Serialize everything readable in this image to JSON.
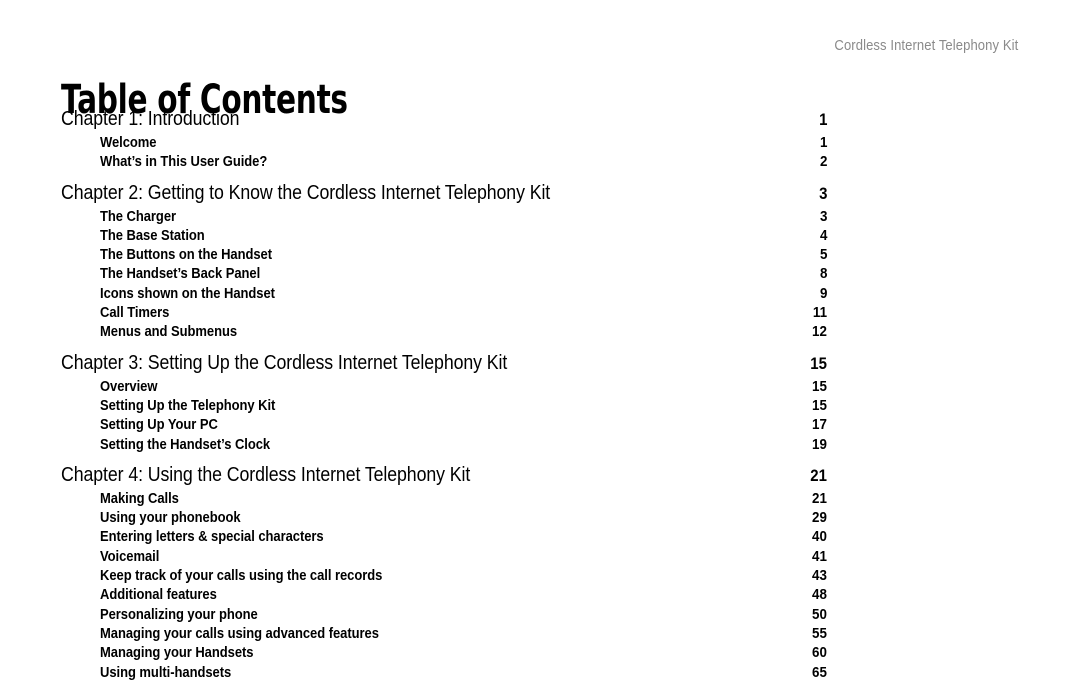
{
  "header": {
    "running_title": "Cordless Internet Telephony Kit"
  },
  "title": "Table of Contents",
  "colors": {
    "text": "#000000",
    "header_gray": "#8a8a8a",
    "background": "#ffffff"
  },
  "toc": {
    "rows": [
      {
        "type": "chapter",
        "label": "Chapter 1: Introduction",
        "page": "1"
      },
      {
        "type": "entry",
        "label": "Welcome",
        "page": "1"
      },
      {
        "type": "entry",
        "label": "What’s in This User Guide?",
        "page": "2"
      },
      {
        "type": "chapter",
        "label": "Chapter 2: Getting to Know the Cordless Internet Telephony Kit",
        "page": "3"
      },
      {
        "type": "entry",
        "label": "The Charger",
        "page": "3"
      },
      {
        "type": "entry",
        "label": "The Base Station",
        "page": "4"
      },
      {
        "type": "entry",
        "label": "The Buttons on the Handset",
        "page": "5"
      },
      {
        "type": "entry",
        "label": "The Handset’s Back Panel",
        "page": "8"
      },
      {
        "type": "entry",
        "label": "Icons shown on the Handset",
        "page": "9"
      },
      {
        "type": "entry",
        "label": "Call Timers",
        "page": "11"
      },
      {
        "type": "entry",
        "label": "Menus and Submenus",
        "page": "12"
      },
      {
        "type": "chapter",
        "label": "Chapter 3: Setting Up the Cordless Internet Telephony Kit",
        "page": "15"
      },
      {
        "type": "entry",
        "label": "Overview",
        "page": "15"
      },
      {
        "type": "entry",
        "label": "Setting Up the Telephony Kit",
        "page": "15"
      },
      {
        "type": "entry",
        "label": "Setting Up Your PC",
        "page": "17"
      },
      {
        "type": "entry",
        "label": "Setting the Handset’s Clock",
        "page": "19"
      },
      {
        "type": "chapter",
        "label": "Chapter 4: Using the Cordless Internet Telephony Kit",
        "page": "21"
      },
      {
        "type": "entry",
        "label": "Making Calls",
        "page": "21"
      },
      {
        "type": "entry",
        "label": "Using your phonebook",
        "page": "29"
      },
      {
        "type": "entry",
        "label": "Entering letters & special characters",
        "page": "40"
      },
      {
        "type": "entry",
        "label": "Voicemail",
        "page": "41"
      },
      {
        "type": "entry",
        "label": "Keep track of your calls using the call records",
        "page": "43"
      },
      {
        "type": "entry",
        "label": "Additional features",
        "page": "48"
      },
      {
        "type": "entry",
        "label": "Personalizing your phone",
        "page": "50"
      },
      {
        "type": "entry",
        "label": "Managing your calls using advanced features",
        "page": "55"
      },
      {
        "type": "entry",
        "label": "Managing your Handsets",
        "page": "60"
      },
      {
        "type": "entry",
        "label": "Using multi-handsets",
        "page": "65"
      }
    ]
  }
}
